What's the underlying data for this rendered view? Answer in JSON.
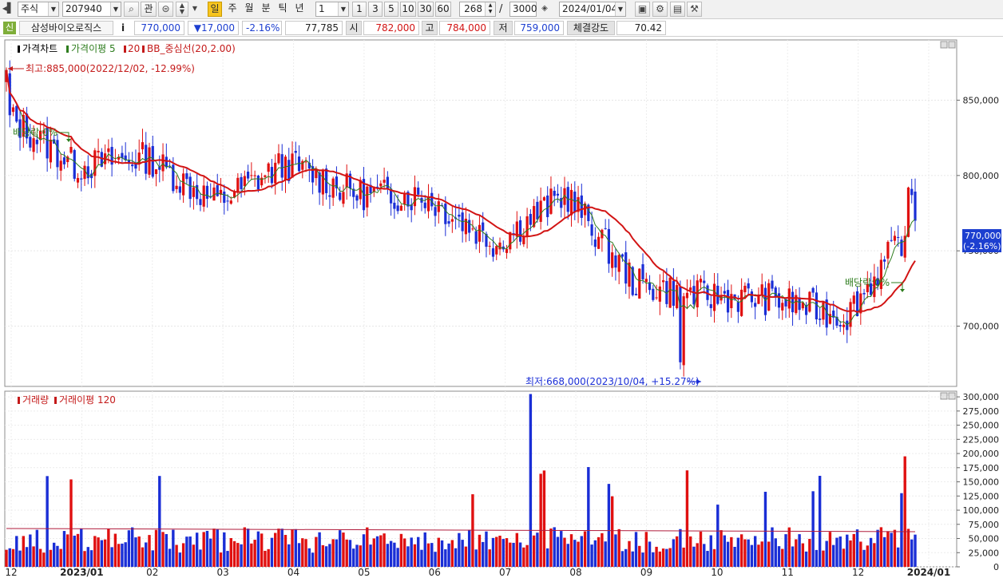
{
  "toolbar": {
    "market": "주식",
    "code": "207940",
    "btn_gwan": "관",
    "periods": [
      "일",
      "주",
      "월",
      "분",
      "틱",
      "년"
    ],
    "active_period": "일",
    "interval_value": "1",
    "interval_buttons": [
      "1",
      "3",
      "5",
      "10",
      "30",
      "60"
    ],
    "count": "268",
    "slash": "/",
    "max_count": "3000",
    "date": "2024/01/04"
  },
  "quote": {
    "badge": "신",
    "name": "삼성바이오로직스",
    "info": "i",
    "price": "770,000",
    "change": "▼17,000",
    "change_pct": "-2.16%",
    "volume": "77,785",
    "open_label": "시",
    "open": "782,000",
    "high_label": "고",
    "high": "784,000",
    "low_label": "저",
    "low": "759,000",
    "strength_label": "체결강도",
    "strength": "70.42"
  },
  "price_panel": {
    "legend": [
      {
        "text": "가격차트",
        "color": "#000000"
      },
      {
        "text": "가격이평 5",
        "color": "#2e7d1e"
      },
      {
        "text": "20",
        "color": "#c41a1a"
      },
      {
        "text": "BB_중심선(20,2.00)",
        "color": "#c41a1a"
      }
    ],
    "high_annotation": "최고:885,000(2022/12/02, -12.99%)",
    "low_annotation": "최저:668,000(2023/10/04, +15.27%)",
    "dividend_label_1": "배당락:0%",
    "dividend_label_2": "배당락:0%",
    "current_price_tag": "770,000",
    "current_pct_tag": "(-2.16%)",
    "y_ticks": [
      "850,000",
      "800,000",
      "750,000",
      "700,000"
    ]
  },
  "volume_panel": {
    "legend": [
      {
        "text": "거래량",
        "color": "#c41a1a"
      },
      {
        "text": "거래이평 120",
        "color": "#c41a1a"
      }
    ],
    "y_ticks": [
      "300,000",
      "275,000",
      "250,000",
      "225,000",
      "200,000",
      "175,000",
      "150,000",
      "125,000",
      "100,000",
      "75,000",
      "50,000",
      "25,000",
      "0"
    ]
  },
  "x_axis": {
    "labels": [
      "12",
      "2023/01",
      "02",
      "03",
      "04",
      "05",
      "06",
      "07",
      "08",
      "09",
      "10",
      "11",
      "12",
      "2024/01"
    ]
  },
  "colors": {
    "up": "#e01010",
    "down": "#1a2ed6",
    "ma5": "#2e7d1e",
    "ma20": "#d21414",
    "price_tag_bg": "#1d3fd0"
  },
  "chart_data": {
    "type": "candlestick",
    "series": [
      {
        "name": "가격차트"
      },
      {
        "name": "가격이평 5"
      },
      {
        "name": "20"
      },
      {
        "name": "BB_중심선(20,2.00)"
      },
      {
        "name": "거래량"
      },
      {
        "name": "거래이평 120"
      }
    ],
    "price_ylim": [
      660000,
      890000
    ],
    "volume_ylim": [
      0,
      310000
    ],
    "monthly_close": [
      {
        "month": "12",
        "close": 840000
      },
      {
        "month": "2023/01",
        "close": 806000
      },
      {
        "month": "02",
        "close": 812000
      },
      {
        "month": "03",
        "close": 782000
      },
      {
        "month": "04",
        "close": 808000
      },
      {
        "month": "05",
        "close": 788000
      },
      {
        "month": "06",
        "close": 786000
      },
      {
        "month": "07",
        "close": 755000
      },
      {
        "month": "08",
        "close": 788000
      },
      {
        "month": "09",
        "close": 728000
      },
      {
        "month": "10",
        "close": 720000
      },
      {
        "month": "11",
        "close": 718000
      },
      {
        "month": "12",
        "close": 706000
      },
      {
        "month": "2024/01",
        "close": 770000
      }
    ],
    "high": 885000,
    "low": 668000,
    "last_close": 770000
  }
}
